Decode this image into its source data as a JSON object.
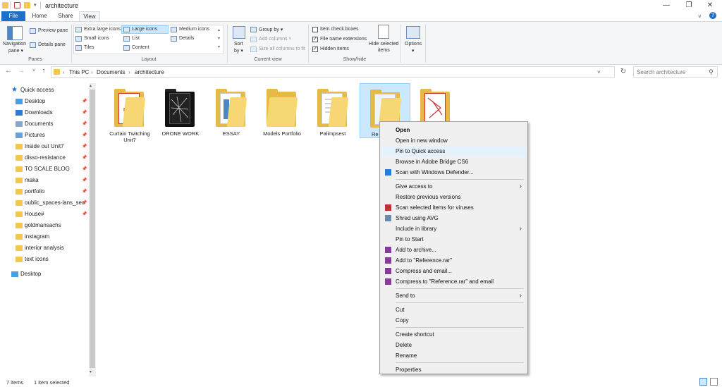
{
  "window": {
    "title": "architecture",
    "controls": {
      "minimize": "—",
      "maximize": "❐",
      "close": "✕"
    }
  },
  "tabs": [
    {
      "label": "File"
    },
    {
      "label": "Home"
    },
    {
      "label": "Share"
    },
    {
      "label": "View"
    }
  ],
  "ribbon": {
    "panes": {
      "navigation_pane": "Navigation",
      "navigation_pane2": "pane ▾",
      "preview_pane": "Preview pane",
      "details_pane": "Details pane",
      "group_label": "Panes"
    },
    "layout": {
      "extra_large": "Extra large icons",
      "large": "Large icons",
      "medium": "Medium icons",
      "small": "Small icons",
      "list": "List",
      "details": "Details",
      "tiles": "Tiles",
      "content": "Content",
      "group_label": "Layout"
    },
    "current_view": {
      "sort_by": "Sort",
      "sort_by2": "by ▾",
      "group_by": "Group by ▾",
      "add_columns": "Add columns ˅",
      "size_all": "Size all columns to fit",
      "group_label": "Current view"
    },
    "show_hide": {
      "item_checkboxes": "Item check boxes",
      "file_ext": "File name extensions",
      "hidden_items": "Hidden items",
      "hide_selected": "Hide selected",
      "hide_selected2": "items",
      "group_label": "Show/hide"
    },
    "options": {
      "label": "Options",
      "arrow": "▾"
    }
  },
  "address": {
    "crumbs": [
      "This PC",
      "Documents",
      "architecture"
    ],
    "search_placeholder": "Search architecture"
  },
  "sidebar": {
    "quick_access": "Quick access",
    "items": [
      {
        "label": "Desktop",
        "pinned": true
      },
      {
        "label": "Downloads",
        "pinned": true
      },
      {
        "label": "Documents",
        "pinned": true
      },
      {
        "label": "Pictures",
        "pinned": true
      },
      {
        "label": "Inside out Unit7",
        "pinned": true
      },
      {
        "label": "disso-resistance",
        "pinned": true
      },
      {
        "label": "TO SCALE BLOG",
        "pinned": true
      },
      {
        "label": "maka",
        "pinned": true
      },
      {
        "label": "portfolio",
        "pinned": true
      },
      {
        "label": "oublic_spaces-lans_sec",
        "pinned": true
      },
      {
        "label": "House#",
        "pinned": true
      },
      {
        "label": "goldmansachs",
        "pinned": false
      },
      {
        "label": "instagram",
        "pinned": false
      },
      {
        "label": "interior analysis",
        "pinned": false
      },
      {
        "label": "text icons",
        "pinned": false
      }
    ],
    "desktop_root": "Desktop"
  },
  "files": [
    {
      "name": "Curtain Twitching Unit7"
    },
    {
      "name": "DRONE WORK"
    },
    {
      "name": "ESSAY"
    },
    {
      "name": "Models Portfolio"
    },
    {
      "name": "Palimpsest"
    },
    {
      "name": "Re"
    },
    {
      "name": ""
    }
  ],
  "context_menu": {
    "items": [
      {
        "label": "Open",
        "bold": true
      },
      {
        "label": "Open in new window"
      },
      {
        "label": "Pin to Quick access",
        "highlight": true
      },
      {
        "label": "Browse in Adobe Bridge CS6"
      },
      {
        "label": "Scan with Windows Defender..."
      },
      {
        "sep": true
      },
      {
        "label": "Give access to",
        "sub": true
      },
      {
        "label": "Restore previous versions"
      },
      {
        "label": "Scan selected items for viruses"
      },
      {
        "label": "Shred using AVG"
      },
      {
        "label": "Include in library",
        "sub": true
      },
      {
        "label": "Pin to Start"
      },
      {
        "label": "Add to archive..."
      },
      {
        "label": "Add to \"Reference.rar\""
      },
      {
        "label": "Compress and email..."
      },
      {
        "label": "Compress to \"Reference.rar\" and email"
      },
      {
        "sep": true
      },
      {
        "label": "Send to",
        "sub": true
      },
      {
        "sep": true
      },
      {
        "label": "Cut"
      },
      {
        "label": "Copy"
      },
      {
        "sep": true
      },
      {
        "label": "Create shortcut"
      },
      {
        "label": "Delete"
      },
      {
        "label": "Rename"
      },
      {
        "sep": true
      },
      {
        "label": "Properties"
      }
    ],
    "sub_arrow": "›"
  },
  "status": {
    "count": "7 items",
    "selected": "1 item selected"
  },
  "colors": {
    "accent": "#1e6fc7",
    "folder": "#f7d774",
    "selection": "#cce8ff"
  }
}
